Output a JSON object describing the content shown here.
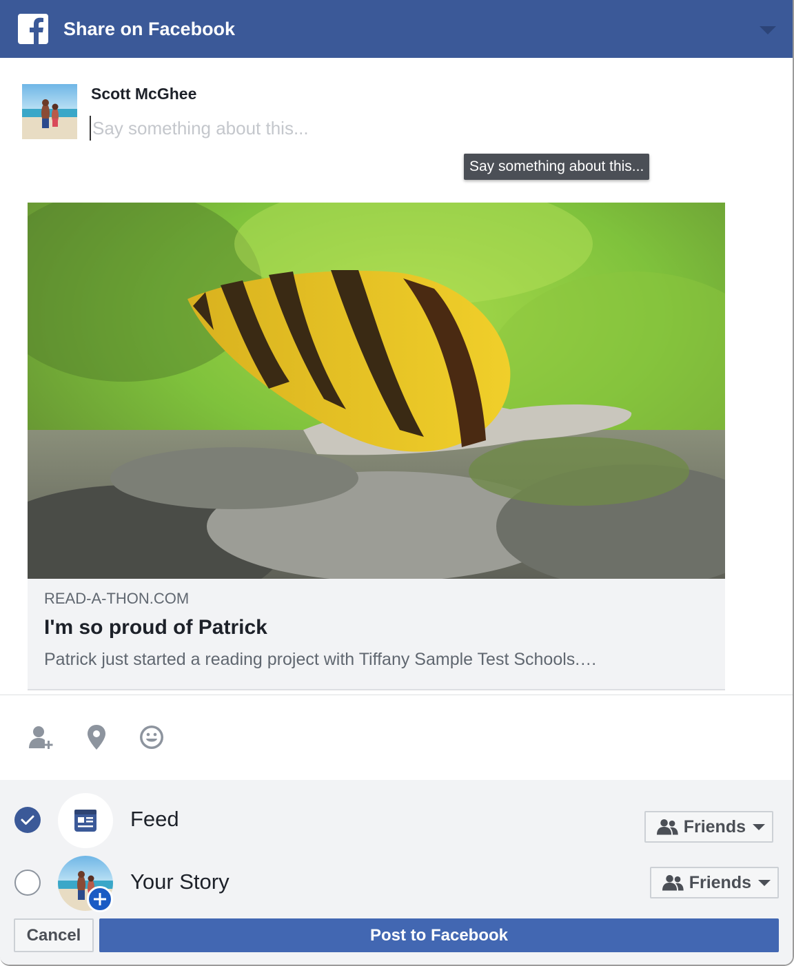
{
  "header": {
    "title": "Share on Facebook"
  },
  "composer": {
    "user_name": "Scott McGhee",
    "input_value": "",
    "placeholder": "Say something about this...",
    "tooltip": "Say something about this..."
  },
  "link_card": {
    "domain": "READ-A-THON.COM",
    "title": "I'm so proud of Patrick",
    "description": "Patrick just started a reading project with Tiffany Sample Test Schools.…",
    "image": "bumblebee-snail-photo"
  },
  "actions": [
    {
      "icon": "tag-friends-icon"
    },
    {
      "icon": "location-pin-icon"
    },
    {
      "icon": "feeling-emoji-icon"
    }
  ],
  "targets": [
    {
      "label": "Feed",
      "checked": true,
      "audience": "Friends",
      "icon": "news-feed-icon"
    },
    {
      "label": "Your Story",
      "checked": false,
      "audience": "Friends",
      "icon": "story-avatar"
    }
  ],
  "buttons": {
    "cancel": "Cancel",
    "post": "Post to Facebook"
  },
  "colors": {
    "header": "#3b5998",
    "post_button": "#4267b2",
    "check": "#3b5998"
  }
}
